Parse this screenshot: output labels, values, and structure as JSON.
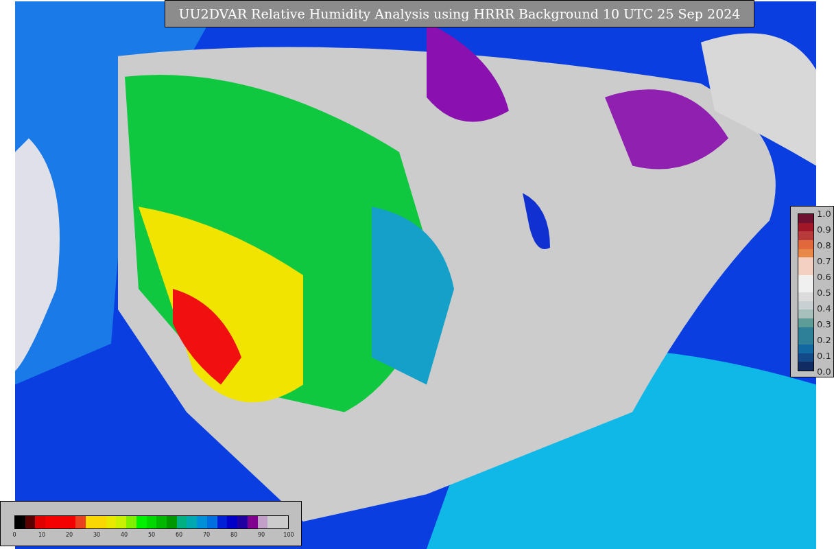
{
  "title": "UU2DVAR Relative Humidity Analysis using HRRR Background 10 UTC 25 Sep 2024",
  "humidity_colorbar": {
    "ticks": [
      "0",
      "10",
      "20",
      "30",
      "40",
      "50",
      "60",
      "70",
      "80",
      "90",
      "100"
    ]
  },
  "observation_colorbar": {
    "ticks": [
      "1.0",
      "0.9",
      "0.8",
      "0.7",
      "0.6",
      "0.5",
      "0.4",
      "0.3",
      "0.2",
      "0.1",
      "0.0"
    ]
  }
}
